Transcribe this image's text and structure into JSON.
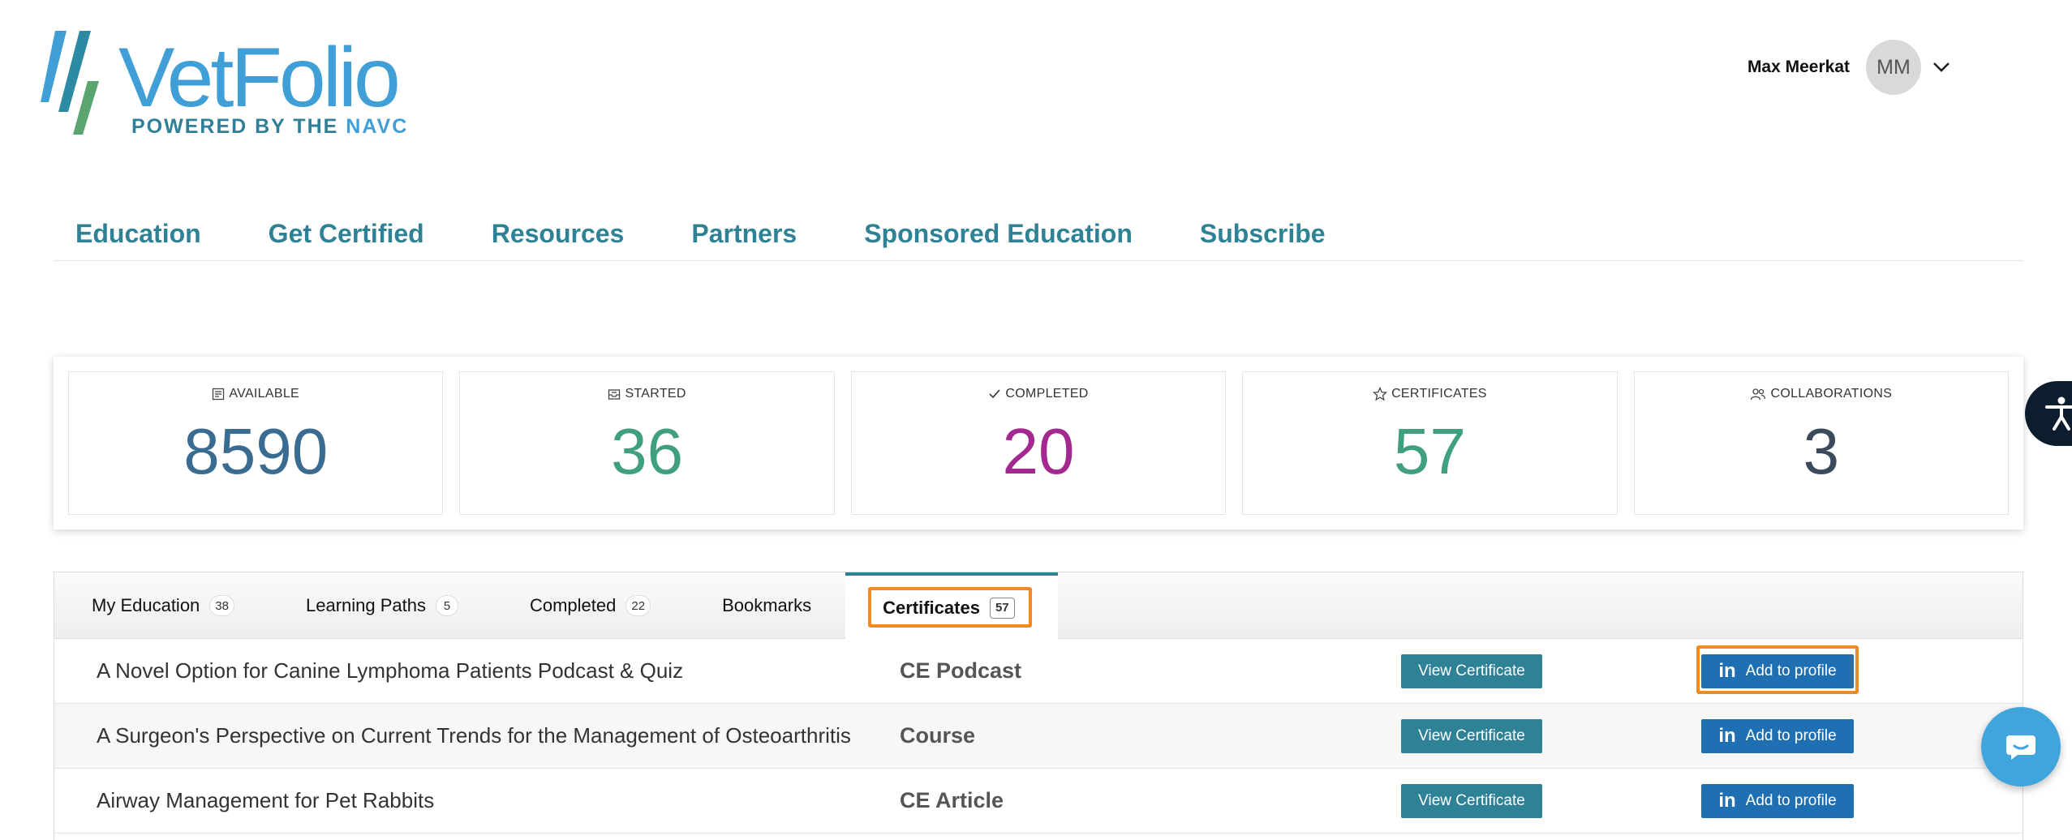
{
  "header": {
    "logo": {
      "name": "VetFolio",
      "tagline_prefix": "POWERED BY THE ",
      "tagline_brand": "NAVC"
    },
    "user": {
      "name": "Max Meerkat",
      "initials": "MM"
    }
  },
  "nav": {
    "items": [
      {
        "label": "Education"
      },
      {
        "label": "Get Certified"
      },
      {
        "label": "Resources"
      },
      {
        "label": "Partners"
      },
      {
        "label": "Sponsored Education"
      },
      {
        "label": "Subscribe"
      }
    ]
  },
  "stats": [
    {
      "label": "AVAILABLE",
      "value": "8590",
      "color": "#3a6b91",
      "icon": "list-icon"
    },
    {
      "label": "STARTED",
      "value": "36",
      "color": "#3f9f7e",
      "icon": "inbox-icon"
    },
    {
      "label": "COMPLETED",
      "value": "20",
      "color": "#a3288f",
      "icon": "check-icon"
    },
    {
      "label": "CERTIFICATES",
      "value": "57",
      "color": "#3f9f7e",
      "icon": "star-icon"
    },
    {
      "label": "COLLABORATIONS",
      "value": "3",
      "color": "#3b4b5c",
      "icon": "users-icon"
    }
  ],
  "tabs": [
    {
      "label": "My Education",
      "count": "38"
    },
    {
      "label": "Learning Paths",
      "count": "5"
    },
    {
      "label": "Completed",
      "count": "22"
    },
    {
      "label": "Bookmarks",
      "count": ""
    },
    {
      "label": "Certificates",
      "count": "57",
      "active": true
    }
  ],
  "certificates": [
    {
      "title": "A Novel Option for Canine Lymphoma Patients Podcast & Quiz",
      "type": "CE Podcast",
      "view_label": "View Certificate",
      "linkedin_label": "Add to profile"
    },
    {
      "title": "A Surgeon's Perspective on Current Trends for the Management of Osteoarthritis",
      "type": "Course",
      "view_label": "View Certificate",
      "linkedin_label": "Add to profile"
    },
    {
      "title": "Airway Management for Pet Rabbits",
      "type": "CE Article",
      "view_label": "View Certificate",
      "linkedin_label": "Add to profile"
    }
  ],
  "linkedin_glyph": "in",
  "colors": {
    "accent": "#2f8296",
    "linkedin": "#1f6fb3",
    "highlight": "#f28a22"
  }
}
